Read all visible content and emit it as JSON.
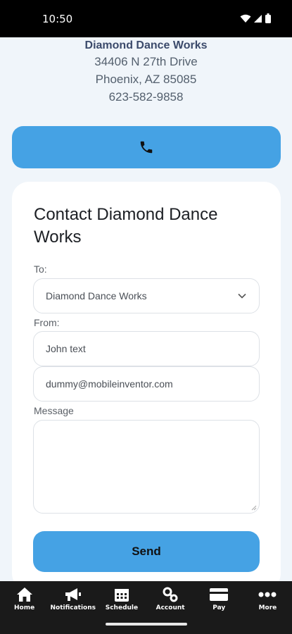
{
  "status": {
    "time": "10:50"
  },
  "business": {
    "name": "Diamond Dance Works",
    "street": "34406 N 27th Drive",
    "city": "Phoenix, AZ 85085",
    "phone": "623-582-9858"
  },
  "form": {
    "title": "Contact Diamond Dance Works",
    "to_label": "To:",
    "to_value": "Diamond Dance Works",
    "from_label": "From:",
    "name_value": "John text",
    "email_value": "dummy@mobileinventor.com",
    "message_label": "Message",
    "message_value": "",
    "send_label": "Send"
  },
  "tabs": [
    {
      "label": "Home",
      "icon": "home-icon"
    },
    {
      "label": "Notifications",
      "icon": "megaphone-icon"
    },
    {
      "label": "Schedule",
      "icon": "calendar-icon"
    },
    {
      "label": "Account",
      "icon": "account-icon"
    },
    {
      "label": "Pay",
      "icon": "credit-card-icon"
    },
    {
      "label": "More",
      "icon": "more-icon"
    }
  ],
  "colors": {
    "accent": "#45a2e4",
    "tabbar": "#1a1a1a",
    "background": "#f0f5fa"
  }
}
